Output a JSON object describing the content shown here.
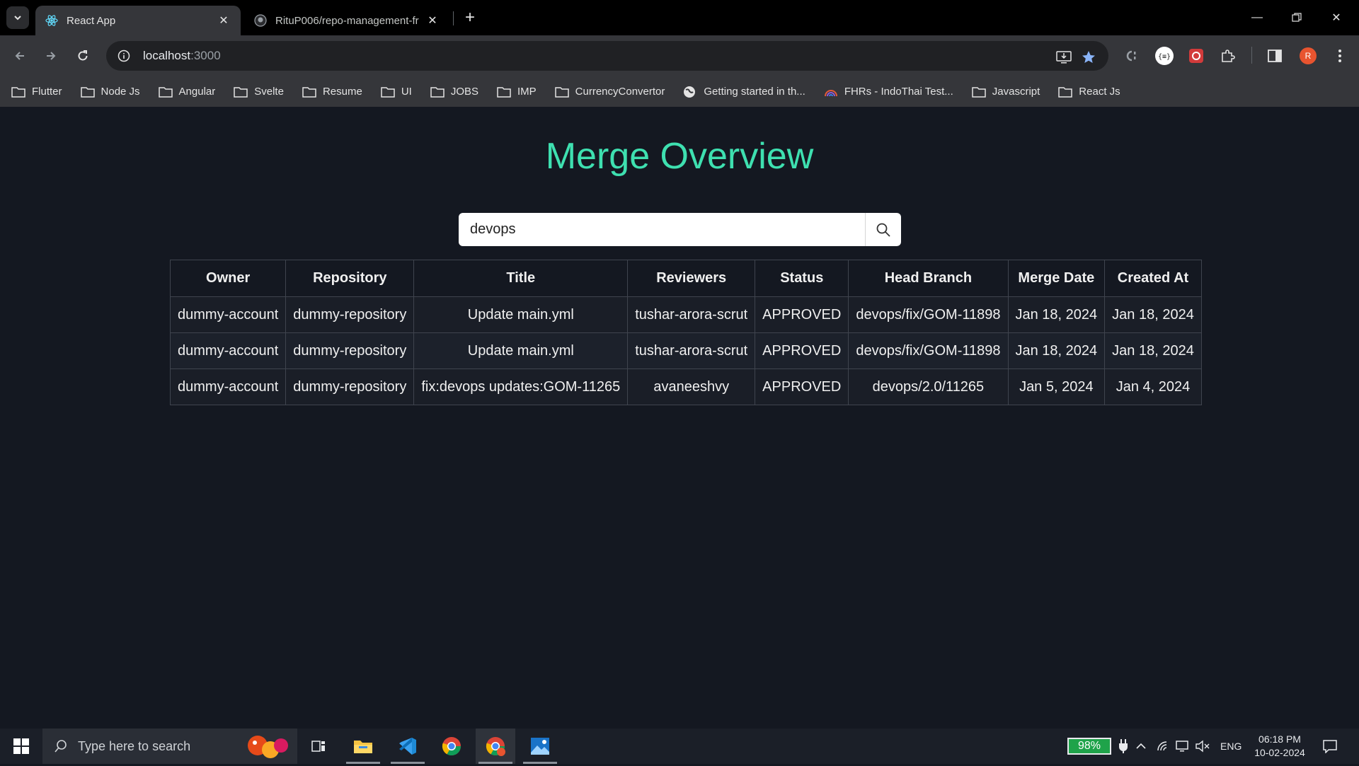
{
  "browser": {
    "tabs": [
      {
        "title": "React App",
        "favicon": "react-icon",
        "active": true
      },
      {
        "title": "RituP006/repo-management-fr",
        "favicon": "github-icon",
        "active": false
      }
    ],
    "address": {
      "host": "localhost",
      "port": ":3000"
    },
    "profile_initial": "R",
    "bookmarks": [
      {
        "label": "Flutter",
        "icon": "folder-icon"
      },
      {
        "label": "Node Js",
        "icon": "folder-icon"
      },
      {
        "label": "Angular",
        "icon": "folder-icon"
      },
      {
        "label": "Svelte",
        "icon": "folder-icon"
      },
      {
        "label": "Resume",
        "icon": "folder-icon"
      },
      {
        "label": "UI",
        "icon": "folder-icon"
      },
      {
        "label": "JOBS",
        "icon": "folder-icon"
      },
      {
        "label": "IMP",
        "icon": "folder-icon"
      },
      {
        "label": "CurrencyConvertor",
        "icon": "folder-icon"
      },
      {
        "label": "Getting started in th...",
        "icon": "globe-icon"
      },
      {
        "label": "FHRs - IndoThai Test...",
        "icon": "rainbow-icon"
      },
      {
        "label": "Javascript",
        "icon": "folder-icon"
      },
      {
        "label": "React Js",
        "icon": "folder-icon"
      }
    ]
  },
  "page": {
    "title": "Merge Overview",
    "search": {
      "value": "devops"
    },
    "table": {
      "headers": [
        "Owner",
        "Repository",
        "Title",
        "Reviewers",
        "Status",
        "Head Branch",
        "Merge Date",
        "Created At"
      ],
      "rows": [
        [
          "dummy-account",
          "dummy-repository",
          "Update main.yml",
          "tushar-arora-scrut",
          "APPROVED",
          "devops/fix/GOM-11898",
          "Jan 18, 2024",
          "Jan 18, 2024"
        ],
        [
          "dummy-account",
          "dummy-repository",
          "Update main.yml",
          "tushar-arora-scrut",
          "APPROVED",
          "devops/fix/GOM-11898",
          "Jan 18, 2024",
          "Jan 18, 2024"
        ],
        [
          "dummy-account",
          "dummy-repository",
          "fix:devops updates:GOM-11265",
          "avaneeshvy",
          "APPROVED",
          "devops/2.0/11265",
          "Jan 5, 2024",
          "Jan 4, 2024"
        ]
      ]
    }
  },
  "taskbar": {
    "search_placeholder": "Type here to search",
    "battery": "98%",
    "language": "ENG",
    "time": "06:18 PM",
    "date": "10-02-2024"
  },
  "colors": {
    "accent": "#3ee0b0",
    "page_bg": "#141821"
  }
}
